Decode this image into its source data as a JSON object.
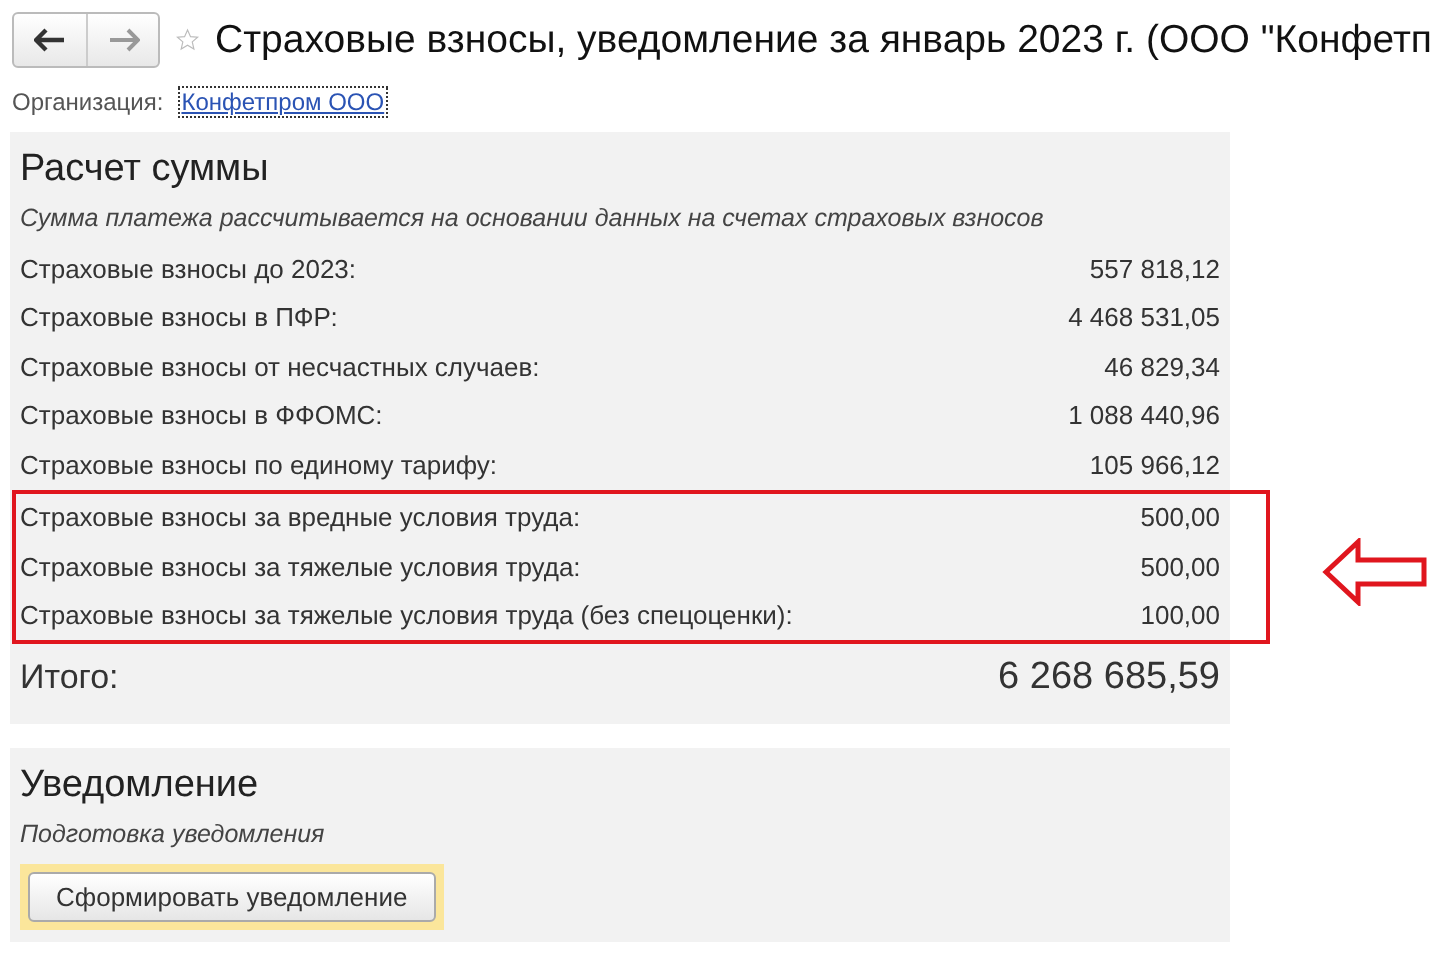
{
  "window": {
    "title": "Страховые взносы, уведомление за январь 2023 г. (ООО \"Конфетп",
    "bookmarked": false
  },
  "organization": {
    "label": "Организация:",
    "value": "Конфетпром ООО"
  },
  "calculation": {
    "title": "Расчет суммы",
    "note": "Сумма платежа рассчитывается на основании данных на счетах страховых взносов",
    "rows": [
      {
        "label": "Страховые взносы до 2023:",
        "value": "557 818,12",
        "highlighted": false
      },
      {
        "label": "Страховые взносы в ПФР:",
        "value": "4 468 531,05",
        "highlighted": false
      },
      {
        "label": "Страховые взносы от несчастных случаев:",
        "value": "46 829,34",
        "highlighted": false
      },
      {
        "label": "Страховые взносы в ФФОМС:",
        "value": "1 088 440,96",
        "highlighted": false
      },
      {
        "label": "Страховые взносы по единому тарифу:",
        "value": "105 966,12",
        "highlighted": false
      },
      {
        "label": "Страховые взносы за вредные условия труда:",
        "value": "500,00",
        "highlighted": true
      },
      {
        "label": "Страховые взносы за тяжелые условия труда:",
        "value": "500,00",
        "highlighted": true
      },
      {
        "label": "Страховые взносы за тяжелые условия труда (без спецоценки):",
        "value": "100,00",
        "highlighted": true
      }
    ],
    "total": {
      "label": "Итого:",
      "value": "6 268 685,59"
    }
  },
  "notification": {
    "title": "Уведомление",
    "note": "Подготовка уведомления",
    "button": "Сформировать уведомление"
  }
}
